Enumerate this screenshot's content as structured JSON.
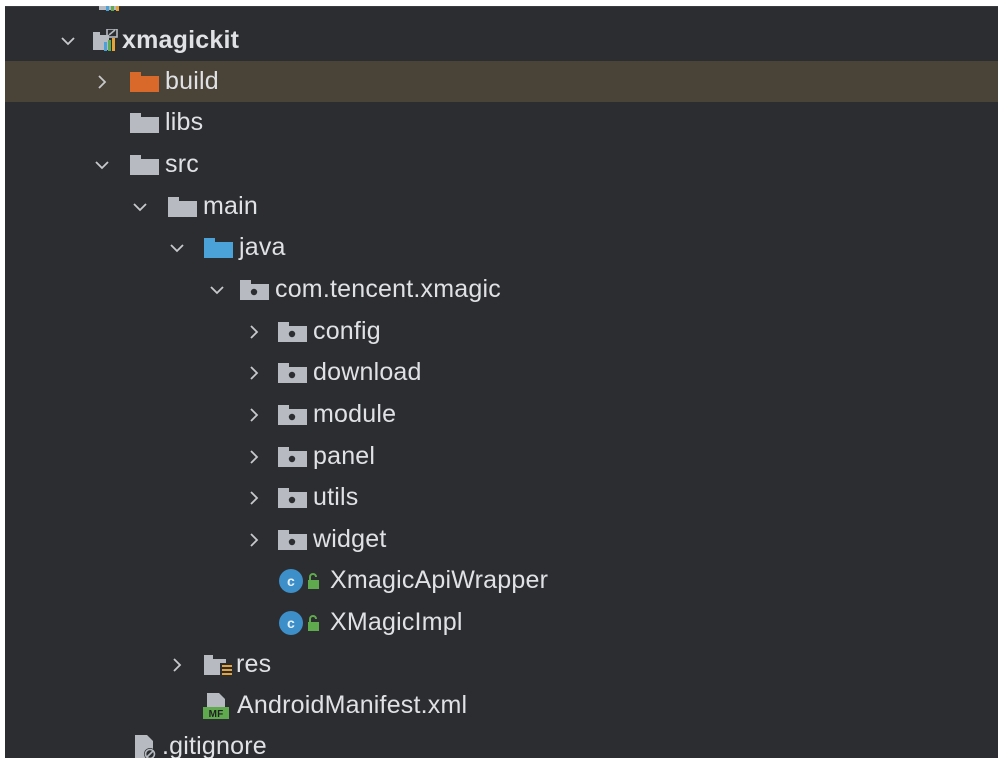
{
  "colors": {
    "panel_bg": "#2b2d30",
    "selected_bg": "#4a4337",
    "text": "#dfe1e5",
    "folder_gray": "#b7bbc1",
    "folder_orange": "#d8692a",
    "folder_blue": "#4aa2d9",
    "class_blue": "#3d8fca",
    "lock_green": "#5faa4c"
  },
  "tree": {
    "rows": [
      {
        "label": "xmagickit",
        "icon": "module-folder-icon",
        "state": "expanded"
      },
      {
        "label": "build",
        "icon": "excluded-folder-icon",
        "state": "collapsed",
        "selected": true
      },
      {
        "label": "libs",
        "icon": "folder-icon",
        "state": "leaf"
      },
      {
        "label": "src",
        "icon": "folder-icon",
        "state": "expanded"
      },
      {
        "label": "main",
        "icon": "folder-icon",
        "state": "expanded"
      },
      {
        "label": "java",
        "icon": "source-root-folder-icon",
        "state": "expanded"
      },
      {
        "label": "com.tencent.xmagic",
        "icon": "package-icon",
        "state": "expanded"
      },
      {
        "label": "config",
        "icon": "package-icon",
        "state": "collapsed"
      },
      {
        "label": "download",
        "icon": "package-icon",
        "state": "collapsed"
      },
      {
        "label": "module",
        "icon": "package-icon",
        "state": "collapsed"
      },
      {
        "label": "panel",
        "icon": "package-icon",
        "state": "collapsed"
      },
      {
        "label": "utils",
        "icon": "package-icon",
        "state": "collapsed"
      },
      {
        "label": "widget",
        "icon": "package-icon",
        "state": "collapsed"
      },
      {
        "label": "XmagicApiWrapper",
        "icon": "class-icon",
        "state": "leaf"
      },
      {
        "label": "XMagicImpl",
        "icon": "class-icon",
        "state": "leaf"
      },
      {
        "label": "res",
        "icon": "resource-folder-icon",
        "state": "collapsed"
      },
      {
        "label": "AndroidManifest.xml",
        "icon": "manifest-file-icon",
        "state": "leaf"
      },
      {
        "label": ".gitignore",
        "icon": "gitignore-file-icon",
        "state": "leaf"
      }
    ]
  }
}
